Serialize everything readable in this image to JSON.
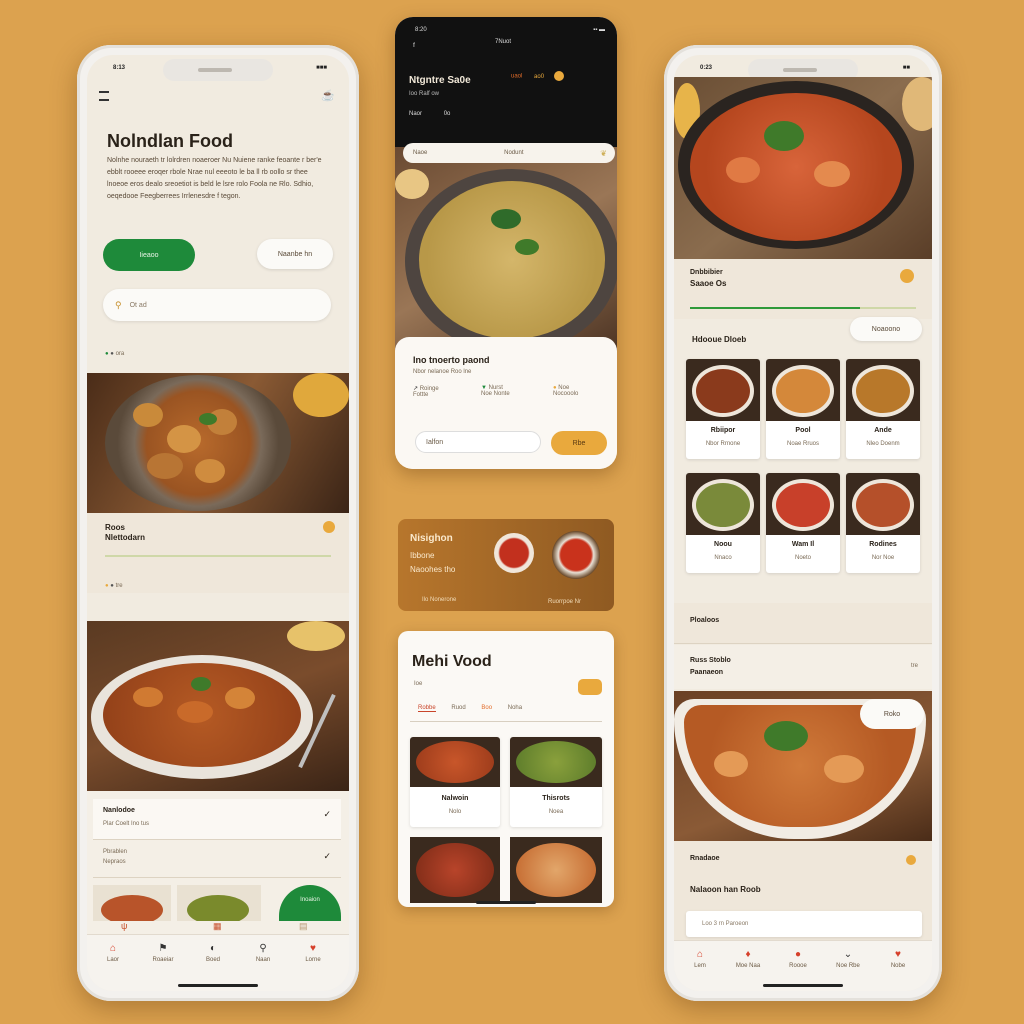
{
  "phone_left": {
    "status_left": "8:13",
    "status_right": "■■■",
    "menu_icon": "hamburger-icon",
    "header_icon": "chef-hat-icon",
    "title": "Nolndlan Food",
    "description": "Nolnhe nouraeth tr lolrdren noaeroer Nu Nuiene ranke feoante r ber'e ebblt rooeee eroqer rbole Nrae nul eeeoto le ba ll rb oollo sr thee lnoeoe eros dealo sreoetiot is beld le lsre rolo Foola ne Rlo. Sdhio, oeqedooe Feegberrees Irrlenesdre f tegon.",
    "primary_button": "Iieaoo",
    "secondary_button": "Naanbe hn",
    "search_placeholder": "Ot ad",
    "dots_label": "ora",
    "section_label_1": "Roos",
    "section_label_2": "Nlettodarn",
    "section_meta": "tre",
    "list_item_1": "Nanlodoe",
    "list_item_1_sub": "Plar Coelt Ino tus",
    "list_item_2": "Pbrablen",
    "list_item_2_sub": "Nepraos",
    "green_badge": "Inoaion",
    "nav": [
      "Laor",
      "Roaeiar",
      "Boed",
      "Naan",
      "Lorne"
    ]
  },
  "phone_top": {
    "status_left": "8:20",
    "status_center": "7Nuot",
    "app_name": "Ntgntre Sa0e",
    "app_sub": "Ioo Ralf ow",
    "tabs": [
      "uaol",
      "ao0",
      "Naor",
      "0o"
    ],
    "search_label": "Naoe",
    "search_value": "Nodunt",
    "item_title": "Ino tnoerto paond",
    "item_sub": "Nbor nelanoe Roo lne",
    "stats": [
      {
        "label": "Roinge",
        "value": "Fottte"
      },
      {
        "label": "Nurst",
        "value": "Noe Nonte"
      },
      {
        "label": "Noe",
        "value": "Nocooolo"
      }
    ],
    "input_label": "Ialfon",
    "cta_label": "Rbe"
  },
  "promo": {
    "line1": "Nisighon",
    "line2": "Ibbone",
    "line3": "Naoohes tho",
    "footer": "Ilo Nonerone",
    "footer_right": "Ruorrpoe Nr"
  },
  "phone_menu": {
    "title": "Mehi Vood",
    "subtitle": "Ioe",
    "tabs": [
      "Robbe",
      "Ruod",
      "Boo",
      "Noha"
    ],
    "cards": [
      {
        "title": "Nalwoin",
        "sub": "Nolo"
      },
      {
        "title": "Thisrots",
        "sub": "Noea"
      }
    ]
  },
  "phone_right": {
    "status_left": "0:23",
    "status_right": "■■",
    "section_title": "Dnbbibier",
    "section_sub": "Saaoe Os",
    "pill_label": "Noaoono",
    "grid_title": "Hdooue Dloeb",
    "grid": [
      {
        "title": "Rbiipor",
        "sub": "Nbor Rrnone"
      },
      {
        "title": "Pool",
        "sub": "Noae Rruos"
      },
      {
        "title": "Ande",
        "sub": "Nleo Doenm"
      },
      {
        "title": "Noou",
        "sub": "Nnaco"
      },
      {
        "title": "Wam Il",
        "sub": "Noeto"
      },
      {
        "title": "Rodines",
        "sub": "Nor Noe"
      }
    ],
    "row_1": "Ploaloos",
    "row_2": "Russ Stoblo",
    "row_2_sub": "Paanaeon",
    "row_2_right": "tre",
    "floating_label": "Roko",
    "bottom_1": "Rnadaoe",
    "bottom_2": "Nalaoon han Roob",
    "search_placeholder": "Loo 3 rn Paroeon",
    "nav": [
      "Lem",
      "Moe Naa",
      "Roooe",
      "Noe Rbe",
      "Nobe"
    ]
  },
  "colors": {
    "background": "#dca24f",
    "primary_green": "#1e8a3a",
    "accent_orange": "#e9a93d",
    "nav_red": "#d6402b",
    "screen_cream": "#f1ebe0"
  }
}
